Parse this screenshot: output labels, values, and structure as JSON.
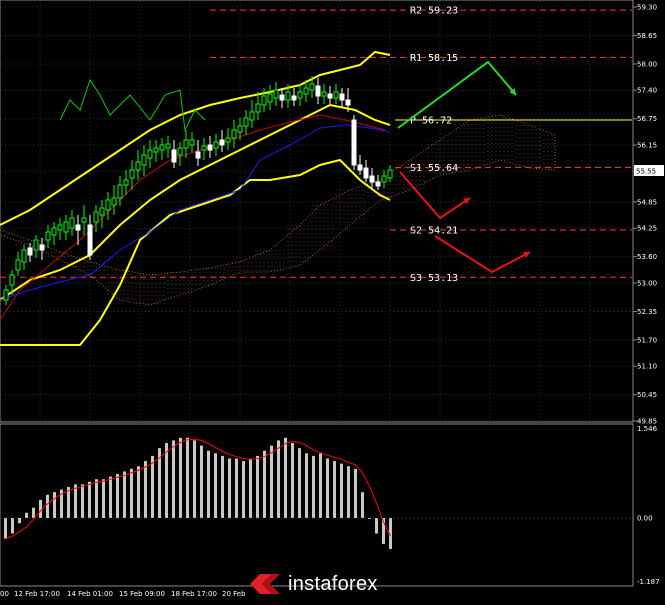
{
  "price_axis": [
    "59.30",
    "58.65",
    "58.00",
    "57.40",
    "56.75",
    "56.15",
    "55.55",
    "54.85",
    "54.25",
    "53.60",
    "53.00",
    "52.35",
    "51.70",
    "51.10",
    "50.45",
    "49.85"
  ],
  "current_price": "55.55",
  "osc_axis": [
    "1.546",
    "0.00",
    "-1.187"
  ],
  "time_axis": [
    "00",
    "12 Feb 17:00",
    "14 Feb 01:00",
    "15 Feb 09:00",
    "18 Feb 17:00",
    "20 Feb"
  ],
  "levels": [
    {
      "label": "R2 59.23",
      "value": 59.23,
      "color": "#ff3b1f",
      "style": "dash"
    },
    {
      "label": "R1 58.15",
      "value": 58.15,
      "color": "#ff3b1f",
      "style": "dash"
    },
    {
      "label": "P 56.72",
      "value": 56.72,
      "color": "#ffff33",
      "style": "solid"
    },
    {
      "label": "S1 55.64",
      "value": 55.64,
      "color": "#ff3b1f",
      "style": "dash"
    },
    {
      "label": "S2 54.21",
      "value": 54.21,
      "color": "#ff3b1f",
      "style": "dash"
    },
    {
      "label": "S3 53.13",
      "value": 53.13,
      "color": "#ff3b1f",
      "style": "dash"
    }
  ],
  "colors": {
    "background": "#000000",
    "bull": "#00ff00",
    "bear": "#ffffff",
    "pivot": "#ffff33",
    "level": "#ff3b1f",
    "bollinger": "#ffff00",
    "ma_red": "#cc0000",
    "ma_blue": "#1a1aff",
    "chikou": "#00cc00",
    "arrow_up": "#22dd22",
    "arrow_down": "#ee1111",
    "histogram": "#c8c8c8",
    "signal": "#ff0000"
  },
  "icons": [
    "instaforex-logo-icon"
  ],
  "watermark": {
    "text": "instaforex"
  }
}
